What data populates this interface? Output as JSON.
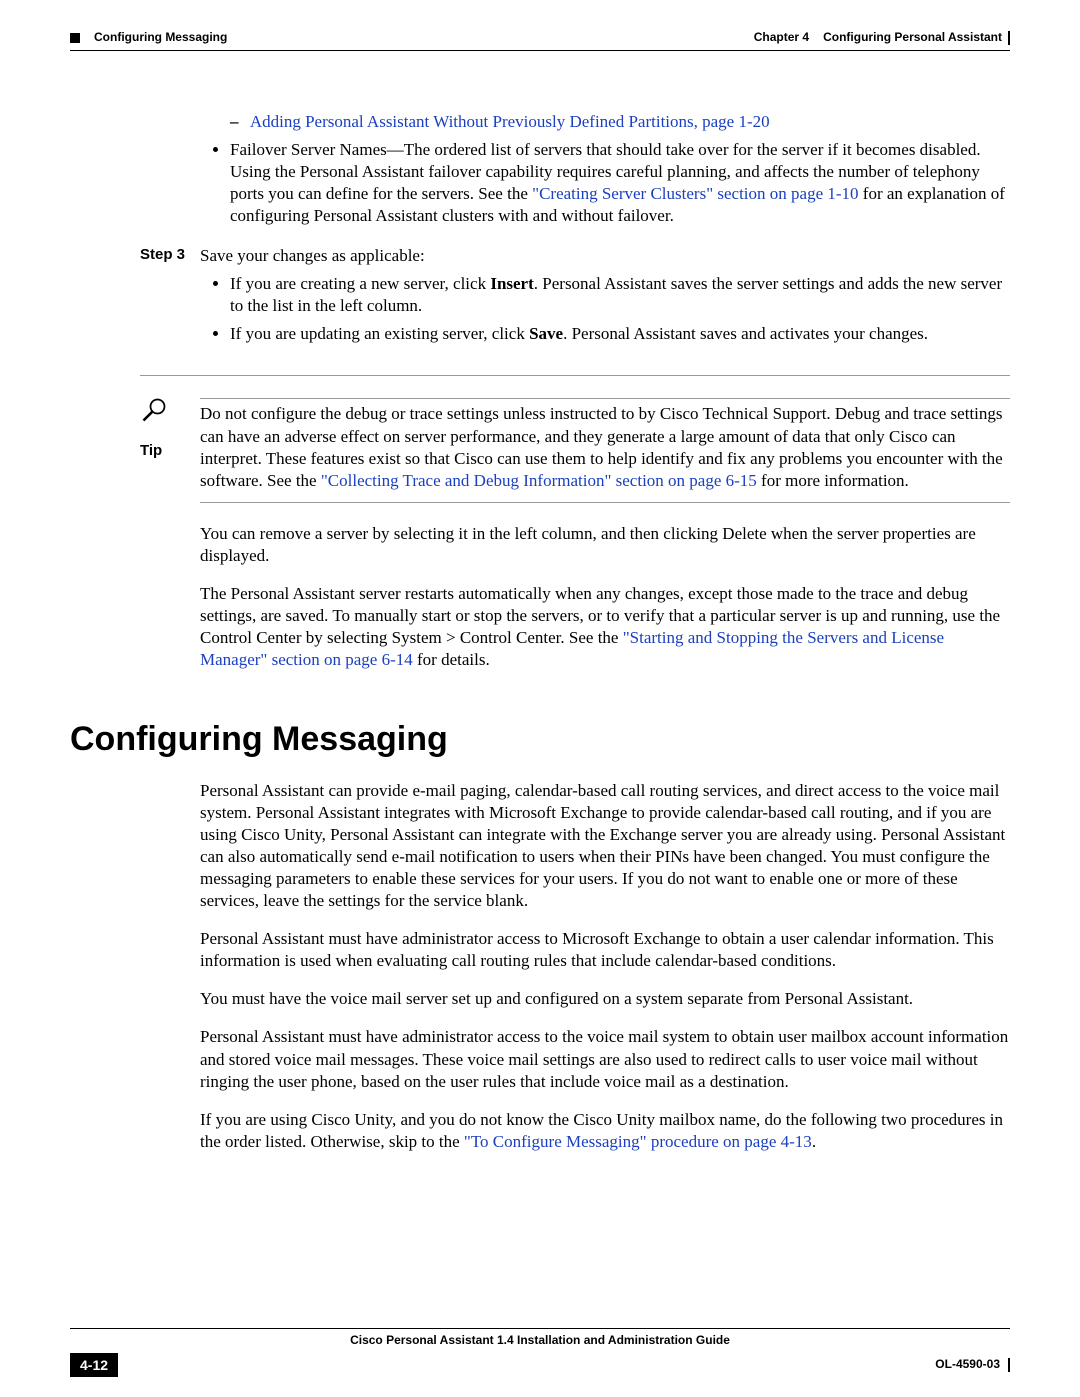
{
  "header": {
    "section": "Configuring Messaging",
    "chapter": "Chapter 4",
    "chapter_title": "Configuring Personal Assistant"
  },
  "body": {
    "link1": "Adding Personal Assistant Without Previously Defined Partitions, page 1-20",
    "bullet_failover_a": "Failover Server Names—The ordered list of servers that should take over for the server if it becomes disabled. Using the Personal Assistant failover capability requires careful planning, and affects the number of telephony ports you can define for the servers. See the ",
    "link2": "\"Creating Server Clusters\" section on page 1-10",
    "bullet_failover_b": " for an explanation of configuring Personal Assistant clusters with and without failover.",
    "step3_label": "Step 3",
    "step3_text": "Save your changes as applicable:",
    "step3_b1_a": "If you are creating a new server, click ",
    "step3_b1_bold": "Insert",
    "step3_b1_b": ". Personal Assistant saves the server settings and adds the new server to the list in the left column.",
    "step3_b2_a": "If you are updating an existing server, click ",
    "step3_b2_bold": "Save",
    "step3_b2_b": ". Personal Assistant saves and activates your changes.",
    "tip_label": "Tip",
    "tip_a": "Do not configure the debug or trace settings unless instructed to by Cisco Technical Support. Debug and trace settings can have an adverse effect on server performance, and they generate a large amount of data that only Cisco can interpret. These features exist so that Cisco can use them to help identify and fix any problems you encounter with the software. See the ",
    "tip_link": "\"Collecting Trace and Debug Information\" section on page 6-15",
    "tip_b": " for more information.",
    "para_remove": "You can remove a server by selecting it in the left column, and then clicking Delete when the server properties are displayed.",
    "para_restart_a": "The Personal Assistant server restarts automatically when any changes, except those made to the trace and debug settings, are saved. To manually start or stop the servers, or to verify that a particular server is up and running, use the Control Center by selecting System > Control Center. See the ",
    "para_restart_link": "\"Starting and Stopping the Servers and License Manager\" section on page 6-14",
    "para_restart_b": " for details.",
    "section_heading": "Configuring Messaging",
    "cm_p1": "Personal Assistant can provide e-mail paging, calendar-based call routing services, and direct access to the voice mail system. Personal Assistant integrates with Microsoft Exchange to provide calendar-based call routing, and if you are using Cisco Unity, Personal Assistant can integrate with the Exchange server you are already using. Personal Assistant can also automatically send e-mail notification to users when their PINs have been changed. You must configure the messaging parameters to enable these services for your users. If you do not want to enable one or more of these services, leave the settings for the service blank.",
    "cm_p2": "Personal Assistant must have administrator access to Microsoft Exchange to obtain a user calendar information. This information is used when evaluating call routing rules that include calendar-based conditions.",
    "cm_p3": "You must have the voice mail server set up and configured on a system separate from Personal Assistant.",
    "cm_p4": "Personal Assistant must have administrator access to the voice mail system to obtain user mailbox account information and stored voice mail messages. These voice mail settings are also used to redirect calls to user voice mail without ringing the user phone, based on the user rules that include voice mail as a destination.",
    "cm_p5_a": "If you are using Cisco Unity, and you do not know the Cisco Unity mailbox name, do the following two procedures in the order listed. Otherwise, skip to the ",
    "cm_p5_link": "\"To Configure Messaging\" procedure on page 4-13",
    "cm_p5_b": "."
  },
  "footer": {
    "book_title": "Cisco Personal Assistant 1.4 Installation and Administration Guide",
    "page_num": "4-12",
    "doc_id": "OL-4590-03"
  }
}
